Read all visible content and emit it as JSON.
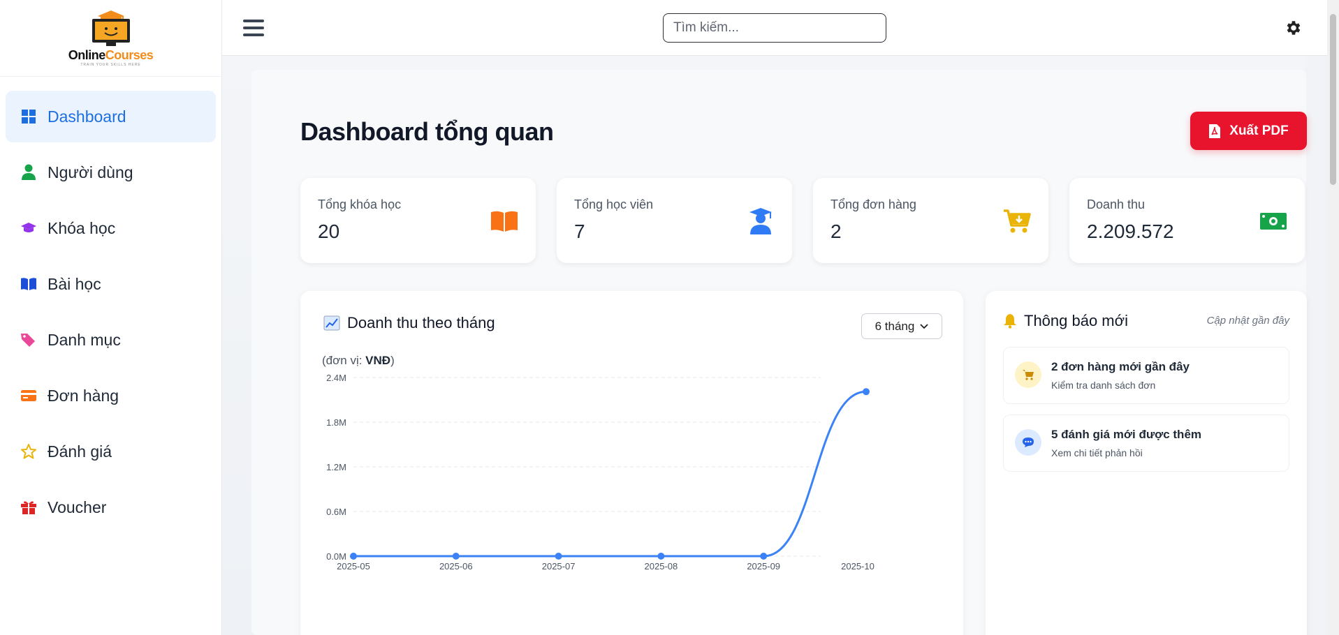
{
  "brand": {
    "name_part1": "Online",
    "name_part2": "Courses",
    "tagline": "TRAIN YOUR SKILLS HERE"
  },
  "sidebar": {
    "items": [
      {
        "label": "Dashboard",
        "icon": "grid-icon",
        "active": true
      },
      {
        "label": "Người dùng",
        "icon": "user-icon"
      },
      {
        "label": "Khóa học",
        "icon": "graduation-cap-icon"
      },
      {
        "label": "Bài học",
        "icon": "book-open-icon"
      },
      {
        "label": "Danh mục",
        "icon": "tags-icon"
      },
      {
        "label": "Đơn hàng",
        "icon": "credit-card-icon"
      },
      {
        "label": "Đánh giá",
        "icon": "star-icon"
      },
      {
        "label": "Voucher",
        "icon": "gift-icon"
      }
    ]
  },
  "topbar": {
    "search_placeholder": "Tìm kiếm..."
  },
  "page": {
    "title": "Dashboard tổng quan",
    "export_label": "Xuất PDF"
  },
  "stats": [
    {
      "label": "Tổng khóa học",
      "value": "20",
      "icon": "book-open-icon",
      "color": "#f97316"
    },
    {
      "label": "Tổng học viên",
      "value": "7",
      "icon": "user-graduate-icon",
      "color": "#2f7bf5"
    },
    {
      "label": "Tổng đơn hàng",
      "value": "2",
      "icon": "cart-download-icon",
      "color": "#eab308"
    },
    {
      "label": "Doanh thu",
      "value": "2.209.572",
      "icon": "money-bill-icon",
      "color": "#16a34a"
    }
  ],
  "chart": {
    "title": "Doanh thu theo tháng",
    "range_label": "6 tháng",
    "unit_prefix": "(đơn vị: ",
    "unit": "VNĐ",
    "unit_suffix": ")"
  },
  "chart_data": {
    "type": "line",
    "categories": [
      "2025-05",
      "2025-06",
      "2025-07",
      "2025-08",
      "2025-09",
      "2025-10"
    ],
    "series": [
      {
        "values": [
          0,
          0,
          0,
          0,
          0,
          2209572
        ],
        "color": "#3b82f6"
      }
    ],
    "yticks": [
      "0.0M",
      "0.6M",
      "1.2M",
      "1.8M",
      "2.4M"
    ],
    "ylim": [
      0,
      2400000
    ],
    "grid": true
  },
  "notifications": {
    "title": "Thông báo mới",
    "subtitle": "Cập nhật gần đây",
    "items": [
      {
        "title": "2 đơn hàng mới gần đây",
        "desc": "Kiểm tra danh sách đơn",
        "icon": "cart-icon"
      },
      {
        "title": "5 đánh giá mới được thêm",
        "desc": "Xem chi tiết phản hồi",
        "icon": "comment-icon"
      }
    ]
  }
}
